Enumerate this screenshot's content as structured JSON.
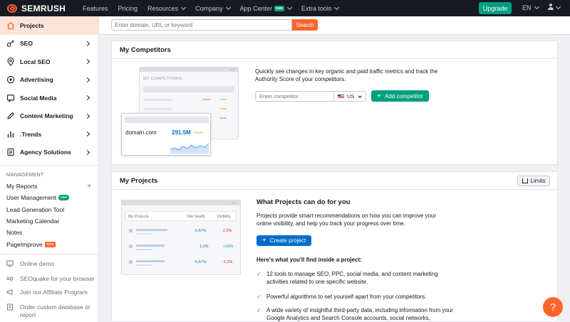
{
  "topbar": {
    "logo_text": "SEMRUSH",
    "nav": [
      {
        "label": "Features",
        "dropdown": false
      },
      {
        "label": "Pricing",
        "dropdown": false
      },
      {
        "label": "Resources",
        "dropdown": true
      },
      {
        "label": "Company",
        "dropdown": true
      },
      {
        "label": "App Center",
        "dropdown": true,
        "badge": "new"
      },
      {
        "label": "Extra tools",
        "dropdown": true
      }
    ],
    "upgrade_label": "Upgrade",
    "language": "EN"
  },
  "sidebar": {
    "items": [
      {
        "label": "Projects",
        "icon": "home-icon",
        "active": true
      },
      {
        "label": "SEO",
        "icon": "key-icon"
      },
      {
        "label": "Local SEO",
        "icon": "map-pin-icon"
      },
      {
        "label": "Advertising",
        "icon": "target-icon"
      },
      {
        "label": "Social Media",
        "icon": "chat-icon"
      },
      {
        "label": "Content Marketing",
        "icon": "pencil-icon"
      },
      {
        "label": ".Trends",
        "icon": "bar-chart-icon"
      },
      {
        "label": "Agency Solutions",
        "icon": "document-icon"
      }
    ],
    "management_title": "MANAGEMENT",
    "management": [
      {
        "label": "My Reports"
      },
      {
        "label": "User Management",
        "badge": "new"
      },
      {
        "label": "Lead Generation Tool"
      },
      {
        "label": "Marketing Calendar"
      },
      {
        "label": "Notes"
      },
      {
        "label": "PageImprove",
        "badge": "beta"
      }
    ],
    "extras": [
      {
        "label": "Online demo",
        "icon": "monitor-icon"
      },
      {
        "label": "SEOquake for your browser",
        "icon": "seoquake-icon"
      },
      {
        "label": "Join our Affiliate Program",
        "icon": "megaphone-icon"
      },
      {
        "label": "Order custom database or report",
        "icon": "report-icon"
      }
    ]
  },
  "search": {
    "placeholder": "Enter domain, URL or keyword",
    "button_label": "Search"
  },
  "competitors": {
    "title": "My Competitors",
    "description": "Quickly see changes in key organic and paid traffic metrics and track the Authority Score of your competitors.",
    "input_placeholder": "Enter competitor",
    "country": "US",
    "add_button": "Add competitor",
    "illustration": {
      "window_title": "MY COMPETITORS",
      "domain": "domain.com",
      "value": "291.5M"
    }
  },
  "projects": {
    "title": "My Projects",
    "limits_label": "Limits",
    "heading": "What Projects can do for you",
    "description": "Projects provide smart recommendations on how you can improve your online visibility, and help you track your progress over time.",
    "create_button": "Create project",
    "inside_title": "Here's what you'll find inside a project:",
    "features": [
      "12 tools to manage SEO, PPC, social media, and content marketing activities related to one specific website.",
      "Powerful algorithms to set yourself apart from your competitors.",
      "A wide variety of insightful third-party data, including information from your Google Analytics and Search Console accounts, social networks,"
    ],
    "illustration": {
      "headers": [
        "My Projects",
        "Site health",
        "Visibility"
      ],
      "rows": [
        {
          "health": "6,57%",
          "visibility": "-2.2%"
        },
        {
          "health": "1,1%",
          "visibility": "+15%"
        },
        {
          "health": "6,57%",
          "visibility": "-1.2%"
        }
      ]
    }
  },
  "help_label": "?",
  "colors": {
    "brand_orange": "#ff642d",
    "green": "#009f81",
    "blue": "#006dca",
    "dark": "#171a22"
  }
}
